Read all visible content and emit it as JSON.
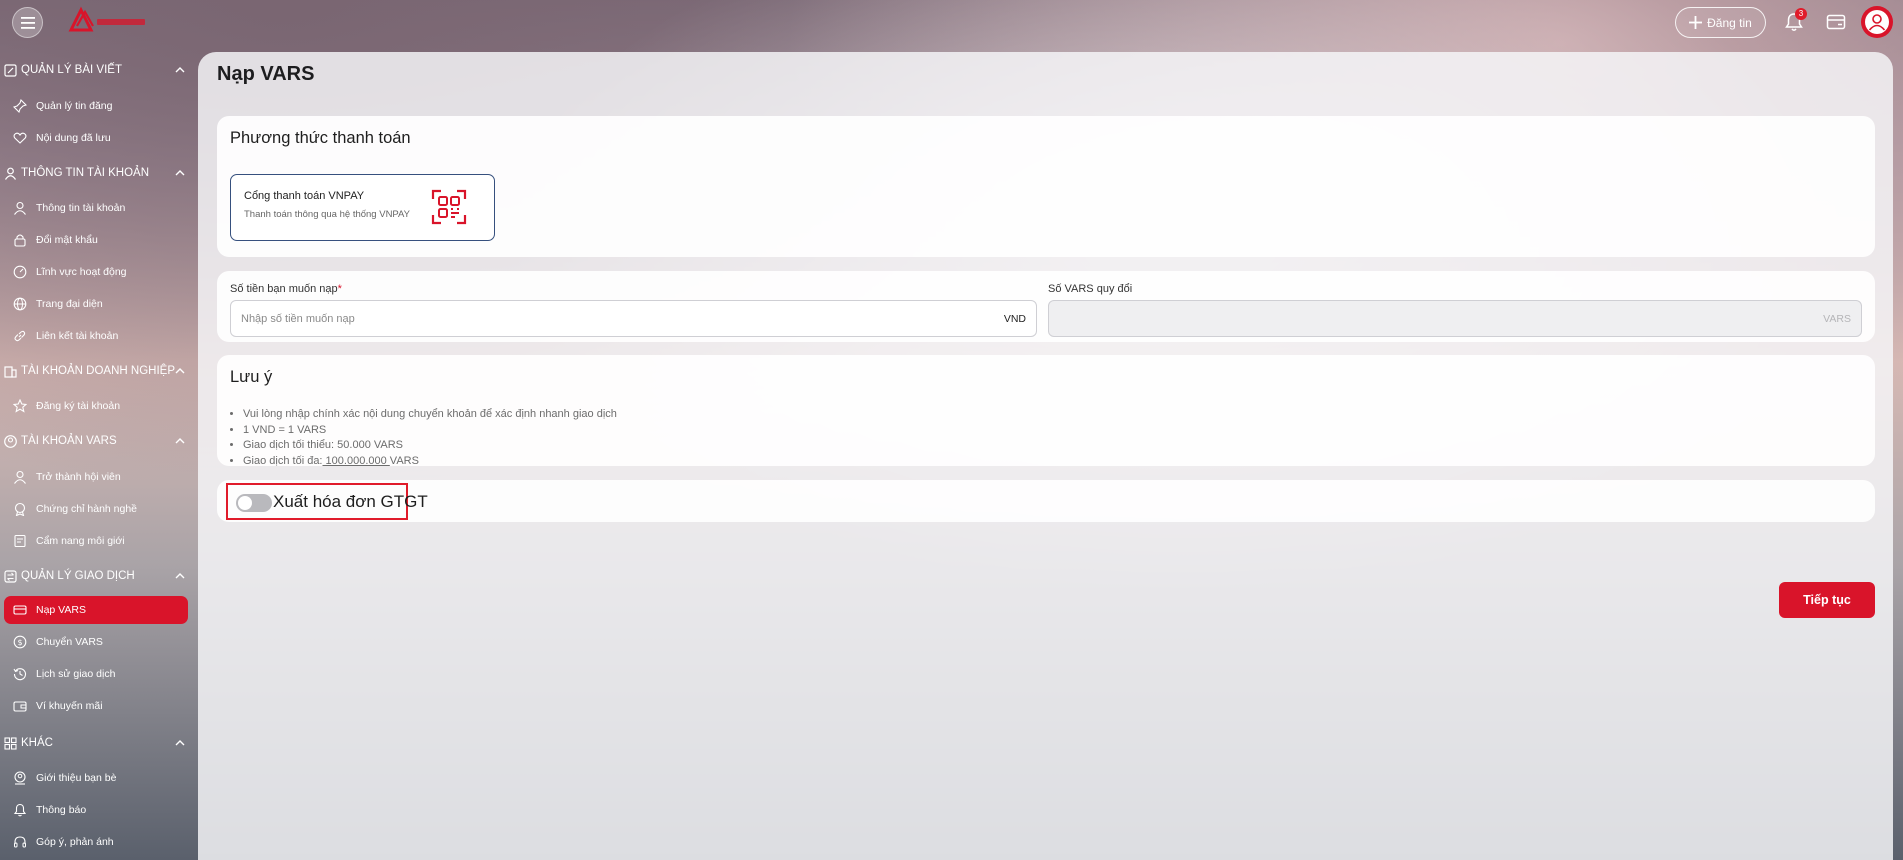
{
  "header": {
    "menu_icon": "hamburger-icon",
    "logo": "brand-logo",
    "post_label": "Đăng tin",
    "notification_count": "3",
    "accent_color": "#d9142a"
  },
  "sidebar": {
    "sections": [
      {
        "title": "QUẢN LÝ BÀI VIẾT",
        "icon": "edit-note-icon",
        "items": [
          {
            "label": "Quản lý tin đăng",
            "icon": "pin-icon"
          },
          {
            "label": "Nội dung đã lưu",
            "icon": "heart-icon"
          }
        ]
      },
      {
        "title": "THÔNG TIN TÀI KHOẢN",
        "icon": "user-icon",
        "items": [
          {
            "label": "Thông tin tài khoản",
            "icon": "user-icon"
          },
          {
            "label": "Đổi mật khẩu",
            "icon": "lock-icon"
          },
          {
            "label": "Lĩnh vực hoạt động",
            "icon": "dashboard-icon"
          },
          {
            "label": "Trang đại diện",
            "icon": "globe-icon"
          },
          {
            "label": "Liên kết tài khoản",
            "icon": "link-icon"
          }
        ]
      },
      {
        "title": "TÀI KHOẢN DOANH NGHIỆP",
        "icon": "building-icon",
        "items": [
          {
            "label": "Đăng ký tài khoản",
            "icon": "star-icon"
          }
        ]
      },
      {
        "title": "TÀI KHOẢN VARS",
        "icon": "account-circle-icon",
        "items": [
          {
            "label": "Trở thành hội viên",
            "icon": "member-icon"
          },
          {
            "label": "Chứng chỉ hành nghề",
            "icon": "certificate-icon"
          },
          {
            "label": "Cẩm nang môi giới",
            "icon": "handbook-icon"
          }
        ]
      },
      {
        "title": "QUẢN LÝ GIAO DỊCH",
        "icon": "transaction-icon",
        "items": [
          {
            "label": "Nạp VARS",
            "icon": "card-icon",
            "active": true
          },
          {
            "label": "Chuyển VARS",
            "icon": "coin-icon"
          },
          {
            "label": "Lịch sử giao dịch",
            "icon": "history-icon"
          },
          {
            "label": "Ví khuyến mãi",
            "icon": "gift-wallet-icon"
          }
        ]
      },
      {
        "title": "KHÁC",
        "icon": "grid-icon",
        "items": [
          {
            "label": "Giới thiệu bạn bè",
            "icon": "friend-icon"
          },
          {
            "label": "Thông báo",
            "icon": "bell-icon"
          },
          {
            "label": "Góp ý, phản ánh",
            "icon": "headset-icon"
          }
        ]
      }
    ]
  },
  "main": {
    "title": "Nạp VARS",
    "payment": {
      "title": "Phương thức thanh toán",
      "option_name": "Cổng thanh toán VNPAY",
      "option_desc": "Thanh toán thông qua hệ thống VNPAY",
      "option_icon": "qr-scan-icon"
    },
    "amount": {
      "label": "Số tiền bạn muốn nạp",
      "required_mark": "*",
      "placeholder": "Nhập số tiền muốn nạp",
      "unit": "VND"
    },
    "converted": {
      "label": "Số VARS quy đổi",
      "unit": "VARS"
    },
    "notes": {
      "title": "Lưu ý",
      "items": [
        "Vui lòng nhập chính xác nội dung chuyển khoản để xác định nhanh giao dịch",
        "1 VND = 1 VARS",
        "Giao dịch tối thiểu: 50.000 VARS"
      ],
      "max_prefix": "Giao dịch tối đa:",
      "max_value": " 100.000.000 ",
      "max_unit": "VARS"
    },
    "invoice": {
      "label": "Xuất hóa đơn GTGT",
      "enabled": false
    },
    "next_label": "Tiếp tục"
  }
}
